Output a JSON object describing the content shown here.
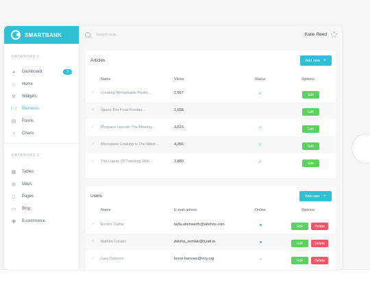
{
  "app": {
    "brand": "SMARTBANK"
  },
  "sidebar": {
    "category1": "CATEGORY 1",
    "category2": "CATEGORY 2",
    "items1": [
      {
        "label": "Dashboard",
        "icon": "palette-icon",
        "badge": "2"
      },
      {
        "label": "Home",
        "icon": "home-icon"
      },
      {
        "label": "Widgets",
        "icon": "puzzle-icon"
      },
      {
        "label": "Elements",
        "icon": "grid-icon",
        "active": true
      },
      {
        "label": "Forms",
        "icon": "form-icon"
      },
      {
        "label": "Charts",
        "icon": "pie-chart-icon"
      }
    ],
    "items2": [
      {
        "label": "Tables",
        "icon": "table-icon"
      },
      {
        "label": "Maps",
        "icon": "globe-icon"
      },
      {
        "label": "Pages",
        "icon": "pages-icon"
      },
      {
        "label": "Blog",
        "icon": "blog-icon"
      },
      {
        "label": "E-commerce",
        "icon": "cart-icon"
      }
    ]
  },
  "topbar": {
    "search_placeholder": "Search now...",
    "user": "Katie Reed"
  },
  "articles": {
    "title": "Articles",
    "add_label": "Add new",
    "headers": {
      "name": "Name",
      "views": "Views",
      "status": "Status",
      "options": "Options"
    },
    "rows": [
      {
        "name": "Creating Remarkable Poster...",
        "views": "2,567"
      },
      {
        "name": "Space The Final Frontier...",
        "views": "1,658"
      },
      {
        "name": "Myspace Layouts The Missing...",
        "views": "3,623"
      },
      {
        "name": "Microwave Cooking Is The Wave...",
        "views": "4,356"
      },
      {
        "name": "The Luxury Of Traveling With...",
        "views": "2,889"
      }
    ],
    "edit_label": "Edit"
  },
  "users": {
    "title": "Users",
    "add_label": "Add user",
    "headers": {
      "name": "Name",
      "email": "E-mail adress",
      "online": "Online",
      "options": "Options"
    },
    "rows": [
      {
        "name": "Eunice Clarke",
        "email": "layla.altenwerth@abshire.com",
        "online": true
      },
      {
        "name": "Nathan Cooper",
        "email": "dalsha_zemlak@hyatt.io",
        "online": true
      },
      {
        "name": "Lura Osborne",
        "email": "leone.barrows@troy.org",
        "online": false
      }
    ],
    "edit_label": "Edit",
    "delete_label": "Delete"
  },
  "colors": {
    "accent": "#2fc0d6",
    "edit": "#5cd061",
    "delete": "#f0566a"
  }
}
